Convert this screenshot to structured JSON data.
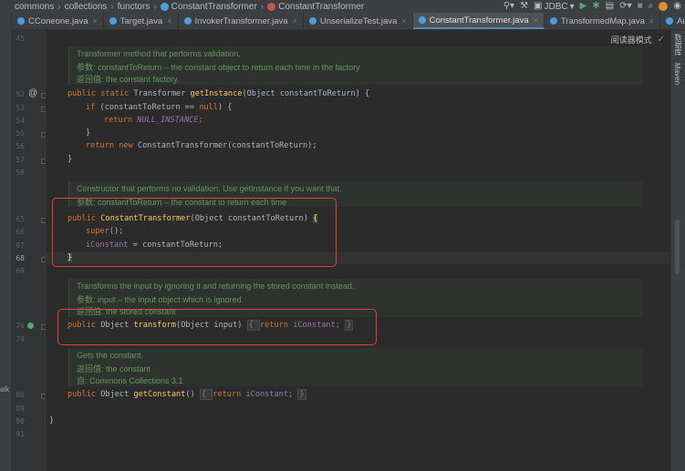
{
  "breadcrumb": [
    "commons",
    "collections",
    "functors",
    "ConstantTransformer",
    "ConstantTransformer"
  ],
  "toolbar": {
    "config_label": "JDBC"
  },
  "tabs": [
    {
      "label": "CConeone.java"
    },
    {
      "label": "Target.java"
    },
    {
      "label": "InvokerTransformer.java"
    },
    {
      "label": "UnserializeTest.java"
    },
    {
      "label": "ConstantTransformer.java"
    },
    {
      "label": "TransformedMap.java"
    },
    {
      "label": "AnnotationInvocationHandler.clas"
    }
  ],
  "editor": {
    "reader_mode": "阅读器模式"
  },
  "right_strip": {
    "database": "数据库",
    "maven": "Maven"
  },
  "left_strip": {
    "label": "alk"
  },
  "line_numbers": [
    "45",
    "52",
    "53",
    "54",
    "55",
    "56",
    "57",
    "58",
    "65",
    "66",
    "67",
    "68",
    "69",
    "76",
    "79",
    "86",
    "89",
    "90",
    "91"
  ],
  "doc_blocks": {
    "getInstance": [
      "Transformer method that performs validation.",
      "参数:    constantToReturn – the constant object to return each time in the factory",
      "返回值: the constant factory."
    ],
    "constructor": [
      "Constructor that performs no validation. Use getInstance if you want that.",
      "参数: constantToReturn – the constant to return each time"
    ],
    "transform": [
      "Transforms the input by ignoring it and returning the stored constant instead.",
      "参数:    input – the input object which is ignored",
      "返回值: the stored constant"
    ],
    "getConstant": [
      "Gets the constant.",
      "返回值: the constant",
      "自:       Commons Collections 3.1"
    ]
  },
  "code": {
    "l52": [
      "public static ",
      "Transformer ",
      "getInstance",
      "(Object constantToReturn) {"
    ],
    "l53": [
      "if ",
      "(constantToReturn == ",
      "null",
      ") {"
    ],
    "l54": [
      "return ",
      "NULL_INSTANCE",
      ";"
    ],
    "l55": "}",
    "l56": [
      "return new ",
      "ConstantTransformer(constantToReturn);"
    ],
    "l57": "}",
    "l65": [
      "public ",
      "ConstantTransformer",
      "(Object constantToReturn) ",
      "{"
    ],
    "l66": [
      "super",
      "();"
    ],
    "l67": [
      "iConstant",
      " = constantToReturn;"
    ],
    "l68": "}",
    "l76": [
      "public ",
      "Object ",
      "transform",
      "(Object input) ",
      "{ ",
      "return ",
      "iConstant",
      "; ",
      "}"
    ],
    "l86": [
      "public ",
      "Object ",
      "getConstant",
      "() ",
      "{ ",
      "return ",
      "iConstant",
      "; ",
      "}"
    ],
    "l90": "}"
  }
}
